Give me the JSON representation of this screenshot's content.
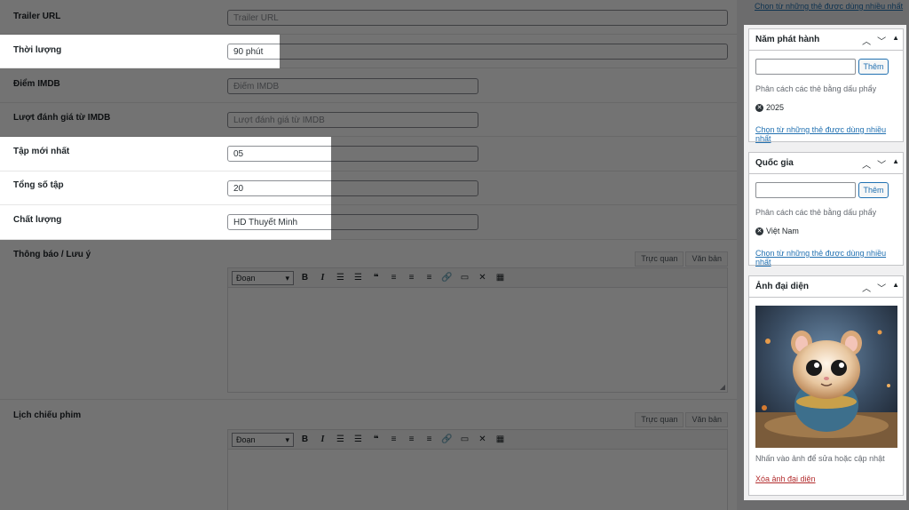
{
  "fields": {
    "trailer_url": {
      "label": "Trailer URL",
      "value": "",
      "placeholder": "Trailer URL"
    },
    "thoi_luong": {
      "label": "Thời lượng",
      "value": "90 phút",
      "placeholder": ""
    },
    "diem_imdb": {
      "label": "Điểm IMDB",
      "value": "",
      "placeholder": "Điểm IMDB"
    },
    "luot_danh_gia": {
      "label": "Lượt đánh giá từ IMDB",
      "value": "",
      "placeholder": "Lượt đánh giá từ IMDB"
    },
    "tap_moi_nhat": {
      "label": "Tập mới nhất",
      "value": "05",
      "placeholder": ""
    },
    "tong_so_tap": {
      "label": "Tổng số tập",
      "value": "20",
      "placeholder": ""
    },
    "chat_luong": {
      "label": "Chất lượng",
      "value": "HD Thuyết Minh",
      "placeholder": ""
    }
  },
  "editors": [
    {
      "label": "Thông báo / Lưu ý",
      "tab_visual": "Trực quan",
      "tab_text": "Văn bản",
      "format": "Đoạn"
    },
    {
      "label": "Lịch chiếu phim",
      "tab_visual": "Trực quan",
      "tab_text": "Văn bản",
      "format": "Đoạn"
    }
  ],
  "toolbar_icons": [
    "bold-icon",
    "italic-icon",
    "bullet-list-icon",
    "numbered-list-icon",
    "blockquote-icon",
    "align-left-icon",
    "align-center-icon",
    "align-right-icon",
    "link-icon",
    "read-more-icon",
    "fullscreen-icon",
    "toolbar-toggle-icon"
  ],
  "sidebar": {
    "top_link": "Chọn từ những thẻ được dùng nhiều nhất",
    "nam_phat_hanh": {
      "title": "Năm phát hành",
      "add_button": "Thêm",
      "hint": "Phân cách các thẻ bằng dấu phẩy",
      "tags": [
        "2025"
      ],
      "link": "Chọn từ những thẻ được dùng nhiều nhất"
    },
    "quoc_gia": {
      "title": "Quốc gia",
      "add_button": "Thêm",
      "hint": "Phân cách các thẻ bằng dấu phẩy",
      "tags": [
        "Việt Nam"
      ],
      "link": "Chọn từ những thẻ được dùng nhiều nhất"
    },
    "anh_dai_dien": {
      "title": "Ảnh đại diện",
      "hint": "Nhấn vào ảnh để sửa hoặc cập nhật",
      "remove_link": "Xóa ảnh đại diện"
    }
  }
}
